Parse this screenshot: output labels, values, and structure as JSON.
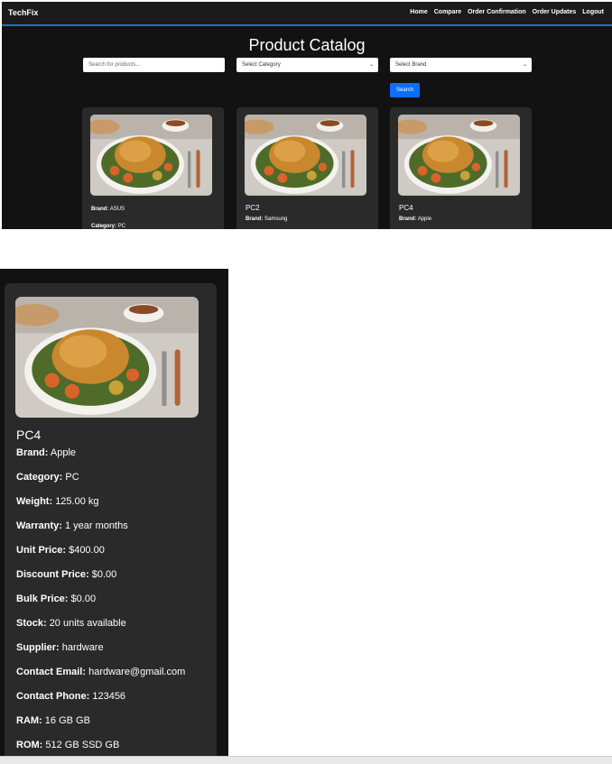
{
  "nav": {
    "brand": "TechFix",
    "links": [
      "Home",
      "Compare",
      "Order Confirmation",
      "Order Updates",
      "Logout"
    ]
  },
  "catalog": {
    "title": "Product Catalog",
    "search_placeholder": "Search for products...",
    "category_select": "Select Category",
    "brand_select": "Select Brand",
    "search_button": "Search"
  },
  "cards": [
    {
      "name": "",
      "brand_label": "Brand:",
      "brand": "ASUS",
      "category_label": "Category:",
      "category": "PC"
    },
    {
      "name": "PC2",
      "brand_label": "Brand:",
      "brand": "Samsung"
    },
    {
      "name": "PC4",
      "brand_label": "Brand:",
      "brand": "Apple"
    }
  ],
  "detail": {
    "name": "PC4",
    "fields": [
      {
        "label": "Brand:",
        "value": "Apple"
      },
      {
        "label": "Category:",
        "value": "PC"
      },
      {
        "label": "Weight:",
        "value": "125.00 kg"
      },
      {
        "label": "Warranty:",
        "value": "1 year months"
      },
      {
        "label": "Unit Price:",
        "value": "$400.00"
      },
      {
        "label": "Discount Price:",
        "value": "$0.00"
      },
      {
        "label": "Bulk Price:",
        "value": "$0.00"
      },
      {
        "label": "Stock:",
        "value": "20 units available"
      },
      {
        "label": "Supplier:",
        "value": "hardware"
      },
      {
        "label": "Contact Email:",
        "value": "hardware@gmail.com"
      },
      {
        "label": "Contact Phone:",
        "value": "123456"
      },
      {
        "label": "RAM:",
        "value": "16 GB GB"
      },
      {
        "label": "ROM:",
        "value": "512 GB SSD GB"
      }
    ]
  },
  "icons": {
    "dropdown": "chevron-down-icon",
    "product_image": "roast-chicken-photo"
  },
  "colors": {
    "accent": "#0d6efd",
    "nav_border": "#1f6fd1",
    "card_bg": "#2a2a2a",
    "page_bg": "#121212"
  }
}
